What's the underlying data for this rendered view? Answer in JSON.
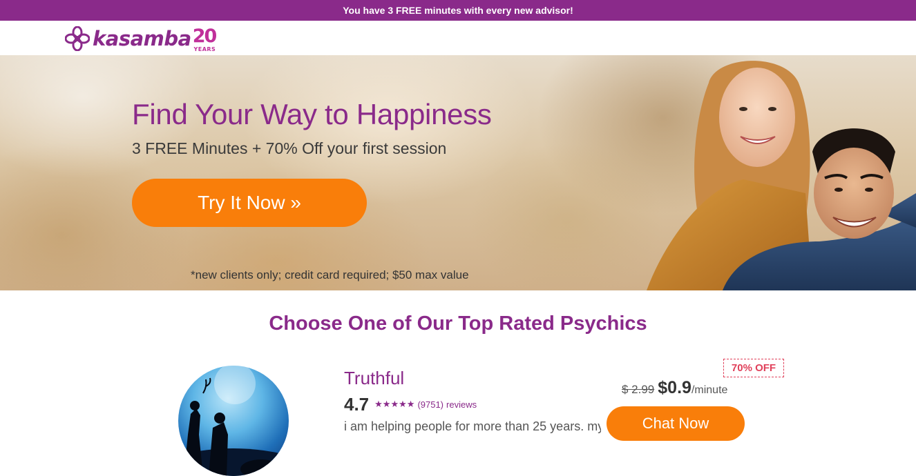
{
  "top_banner": {
    "text": "You have 3 FREE minutes with every new advisor!",
    "bg_color": "#8a2a8a"
  },
  "header": {
    "logo": {
      "icon": "kasamba-flower-icon",
      "word": "kasamba",
      "anniversary_number": "20",
      "anniversary_label": "YEARS"
    }
  },
  "hero": {
    "title": "Find Your Way to Happiness",
    "subtitle": "3 FREE Minutes + 70% Off your first session",
    "cta_label": "Try It Now »",
    "disclaimer": "*new clients only; credit card required; $50 max value",
    "image": "smiling-couple-photo"
  },
  "section": {
    "title": "Choose One of Our Top Rated Psychics"
  },
  "advisor": {
    "name": "Truthful",
    "rating": "4.7",
    "stars": "★★★★★",
    "reviews_count": "(9751)",
    "reviews_label": "reviews",
    "description": "i am helping people for more than 25 years. my",
    "discount": "70% OFF",
    "old_price": "$ 2.99",
    "new_price": "$0.9",
    "per_unit": "/minute",
    "chat_label": "Chat Now"
  },
  "colors": {
    "brand_purple": "#8a2a8a",
    "accent_orange": "#f97e0a",
    "discount_red": "#e0405a"
  }
}
